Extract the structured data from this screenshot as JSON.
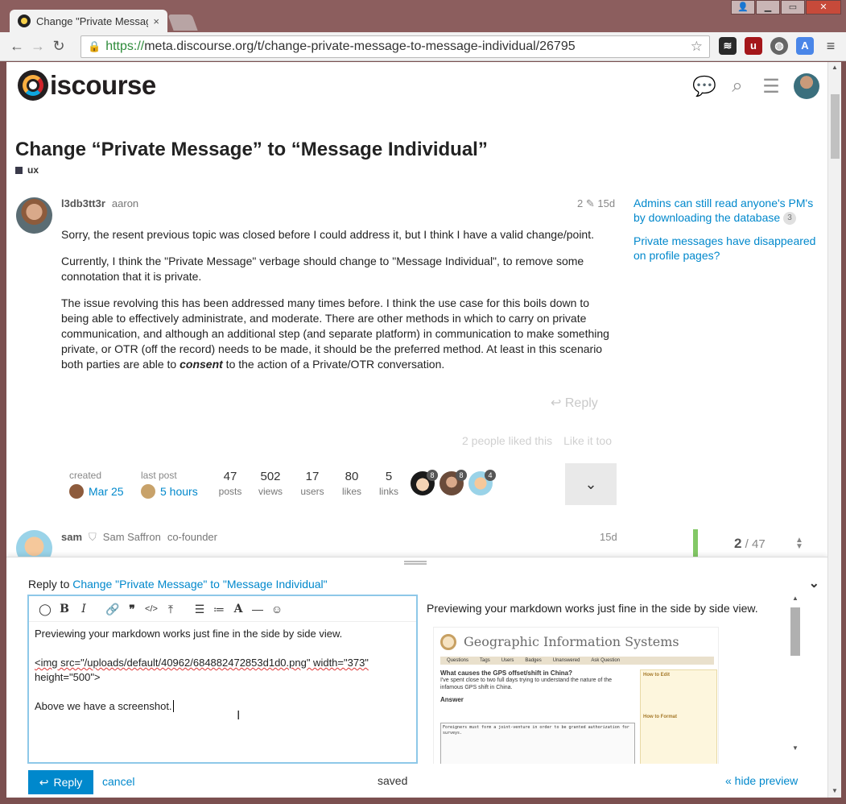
{
  "browser": {
    "tab_title": "Change \"Private Message",
    "tab_close": "×",
    "url_scheme": "https://",
    "url_rest": "meta.discourse.org/t/change-private-message-to-message-individual/26795",
    "back": "←",
    "forward": "→",
    "reload": "↻",
    "star": "☆",
    "menu": "≡"
  },
  "header": {
    "logo_text": "iscourse"
  },
  "topic": {
    "title": "Change “Private Message” to “Message Individual”",
    "category": "ux"
  },
  "post1": {
    "username": "l3db3tt3r",
    "fullname": "aaron",
    "edits": "2",
    "age": "15d",
    "paragraphs": [
      "Sorry, the resent previous topic was closed before I could address it, but I think I have a valid change/point.",
      "Currently, I think the \"Private Message\" verbage should change to \"Message Individual\", to remove some connotation that it is private.",
      "The issue revolving this has been addressed many times before. I think the use case for this boils down to being able to effectively administrate, and moderate. There are other methods in which to carry on private communication, and although an additional step (and separate platform) in communication to make something private, or OTR (off the record) needs to be made, it should be the preferred method. At least in this scenario both parties are able to "
    ],
    "emphasis": "consent",
    "para3_end": " to the action of a Private/OTR conversation.",
    "reply": "Reply",
    "likes_text": "2 people liked this",
    "like_too": "Like it too"
  },
  "topic_map": {
    "created_label": "created",
    "created_value": "Mar 25",
    "last_post_label": "last post",
    "last_post_value": "5 hours",
    "stats": [
      {
        "num": "47",
        "label": "posts"
      },
      {
        "num": "502",
        "label": "views"
      },
      {
        "num": "17",
        "label": "users"
      },
      {
        "num": "80",
        "label": "likes"
      },
      {
        "num": "5",
        "label": "links"
      }
    ],
    "participants": [
      "8",
      "8",
      "4"
    ],
    "expand": "⌄"
  },
  "suggested": [
    {
      "title": "Admins can still read anyone's PM's by downloading the database",
      "count": "3"
    },
    {
      "title": "Private messages have disappeared on profile pages?"
    }
  ],
  "post2": {
    "username": "sam",
    "fullname": "Sam Saffron",
    "title": "co-founder",
    "age": "15d"
  },
  "progress": {
    "current": "2",
    "sep": " / ",
    "total": "47"
  },
  "composer": {
    "reply_to_prefix": "Reply to ",
    "reply_to_link": "Change \"Private Message\" to \"Message Individual\"",
    "editor_lines": [
      "Previewing your markdown works just fine in the side by side view.",
      "",
      "<img src=\"/uploads/default/40962/684882472853d1d0.png\" width=\"373\"",
      "height=\"500\">",
      "",
      "Above we have a screenshot."
    ],
    "preview_text": "Previewing your markdown works just fine in the side by side view.",
    "reply_button": "Reply",
    "cancel": "cancel",
    "status": "saved",
    "hide_preview": "« hide preview"
  },
  "preview_image": {
    "site_title": "Geographic Information Systems",
    "nav": [
      "Questions",
      "Tags",
      "Users",
      "Badges",
      "Unanswered",
      "Ask Question"
    ],
    "question_title": "What causes the GPS offset/shift in China?",
    "question_excerpt": "I've spent close to two full days trying to understand the nature of the infamous GPS shift in China.",
    "answer_label": "Answer",
    "side_title": "How to Edit",
    "side_title2": "How to Format",
    "editor_excerpt": "Foreigners must form a joint-venture in order to be granted authorization for surveys."
  }
}
